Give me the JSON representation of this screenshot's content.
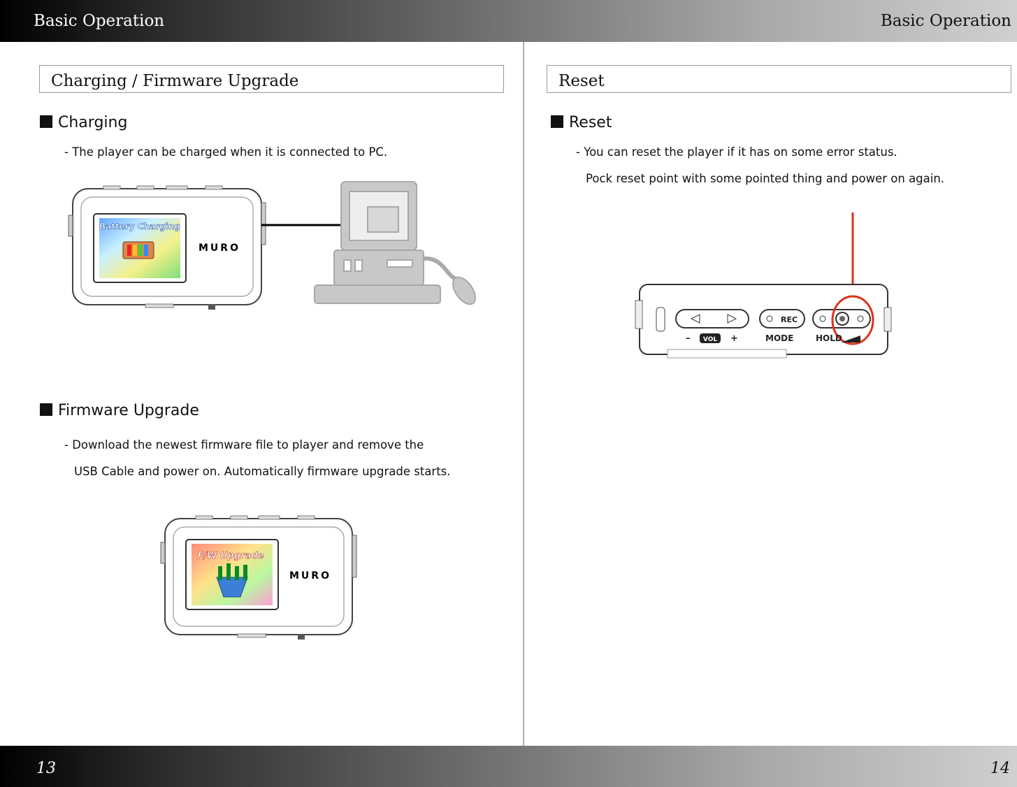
{
  "header": {
    "left_title": "Basic Operation",
    "right_title": "Basic Operation"
  },
  "footer": {
    "left_page": "13",
    "right_page": "14"
  },
  "left": {
    "section_title": "Charging / Firmware Upgrade",
    "charging": {
      "heading": "Charging",
      "line1": "- The player can be charged when it is connected to PC.",
      "screen_label": "Battery Charging",
      "brand": "MURO"
    },
    "firmware": {
      "heading": "Firmware Upgrade",
      "line1": "- Download the newest firmware file to player and remove the",
      "line2": "USB Cable and power on.  Automatically firmware upgrade starts.",
      "screen_label": "F/W  Upgrade",
      "brand": "MURO"
    }
  },
  "right": {
    "section_title": "Reset",
    "reset": {
      "heading": "Reset",
      "line1": "- You can reset the player if it has on some error status.",
      "line2": "Pock reset point with some pointed thing and power on again."
    },
    "device_labels": {
      "minus": "–",
      "vol": "VOL",
      "plus": "+",
      "mode": "MODE",
      "hold": "HOLD",
      "rec": "REC"
    }
  },
  "colors": {
    "highlight": "#e0321c",
    "bar_dark": "#000000",
    "bar_light": "#d0d0d0"
  }
}
